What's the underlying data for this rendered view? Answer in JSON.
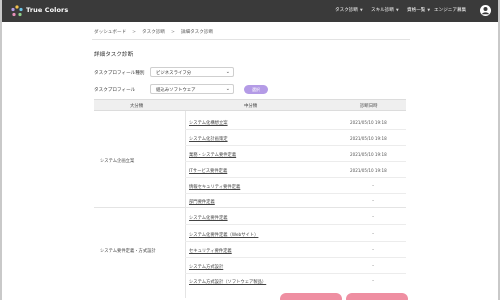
{
  "header": {
    "brand": "True Colors",
    "nav": [
      {
        "label": "タスク診断",
        "dropdown": true
      },
      {
        "label": "スキル診断",
        "dropdown": true
      },
      {
        "label": "資格一覧",
        "dropdown": true
      },
      {
        "label": "エンジニア募集",
        "dropdown": false
      }
    ]
  },
  "breadcrumb": {
    "items": [
      "ダッシュボード",
      "タスク診断",
      "詳細タスク診断"
    ],
    "separator": ">"
  },
  "page_title": "詳細タスク診断",
  "form": {
    "category_label": "タスクプロフィール種別",
    "category_value": "ビジネスライフ分",
    "profile_label": "タスクプロフィール",
    "profile_value": "組込みソフトウェア",
    "select_button": "選択"
  },
  "table": {
    "headers": {
      "major": "大分類",
      "middle": "中分類",
      "date": "診断日時"
    },
    "groups": [
      {
        "name": "システム企画立案",
        "rows": [
          {
            "name": "システム化構想立案",
            "date": "2021/05/10 19:18"
          },
          {
            "name": "システム化計画策定",
            "date": "2021/05/10 19:18"
          },
          {
            "name": "業務・システム要件定義",
            "date": "2021/05/10 19:18"
          },
          {
            "name": "ITサービス要件定義",
            "date": "2021/05/10 19:18"
          },
          {
            "name": "情報セキュリティ要件定義",
            "date": "–"
          },
          {
            "name": "部門要件定義",
            "date": "–"
          }
        ]
      },
      {
        "name": "システム要件定義・方式設計",
        "rows": [
          {
            "name": "システム化要件定義",
            "date": "–"
          },
          {
            "name": "システム化要件定義（Webサイト）",
            "date": "–"
          },
          {
            "name": "セキュリティ要件定義",
            "date": "–"
          },
          {
            "name": "システム方式設計",
            "date": "–"
          },
          {
            "name": "システム方式設計（ソフトウェア製品）",
            "date": "–"
          }
        ]
      }
    ]
  },
  "colors": {
    "header_bg": "#3a3a3a",
    "accent": "#b49be6",
    "action_pink": "#ef8fa2"
  },
  "icons": [
    "true-colors-logo-icon",
    "chevron-down-icon",
    "user-avatar-icon"
  ]
}
